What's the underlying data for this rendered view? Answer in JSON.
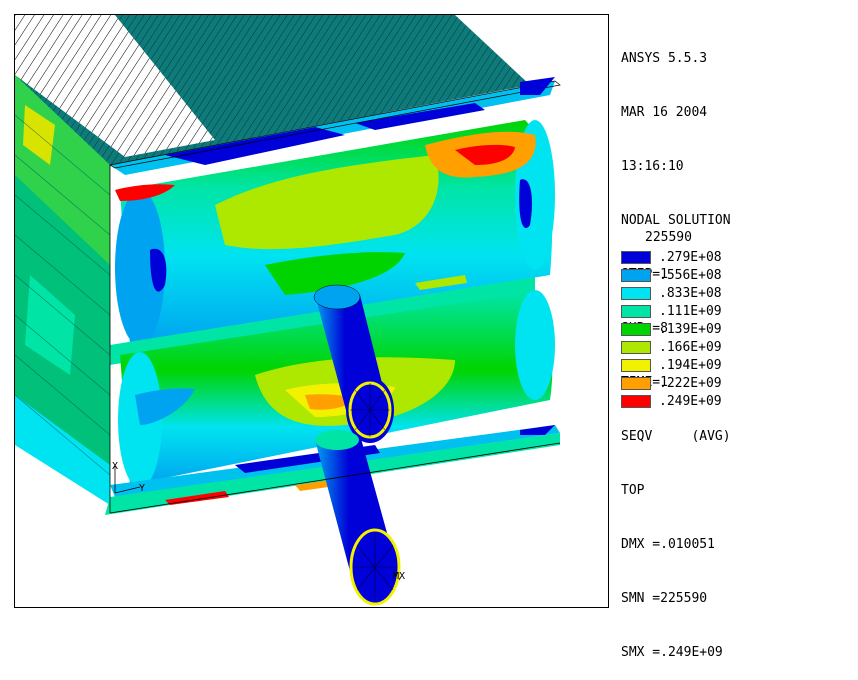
{
  "header": {
    "lines": [
      "ANSYS 5.5.3",
      "MAR 16 2004",
      "13:16:10",
      "NODAL SOLUTION",
      "STEP=1",
      "SUB =8",
      "TIME=1",
      "SEQV     (AVG)",
      "TOP",
      "DMX =.010051",
      "SMN =225590",
      "SMX =.249E+09"
    ]
  },
  "legend": {
    "min_label": "225590",
    "items": [
      {
        "label": ".279E+08",
        "color": "#0000d8"
      },
      {
        "label": ".556E+08",
        "color": "#00a3f0"
      },
      {
        "label": ".833E+08",
        "color": "#00e3f0"
      },
      {
        "label": ".111E+09",
        "color": "#00e5a6"
      },
      {
        "label": ".139E+09",
        "color": "#00d400"
      },
      {
        "label": ".166E+09",
        "color": "#aee800"
      },
      {
        "label": ".194E+09",
        "color": "#f2f200"
      },
      {
        "label": ".222E+09",
        "color": "#ffa000"
      },
      {
        "label": ".249E+09",
        "color": "#ff0000"
      }
    ]
  },
  "viewport_markers": {
    "origin_x": "X",
    "origin_y": "Y",
    "max_marker": "MX"
  }
}
